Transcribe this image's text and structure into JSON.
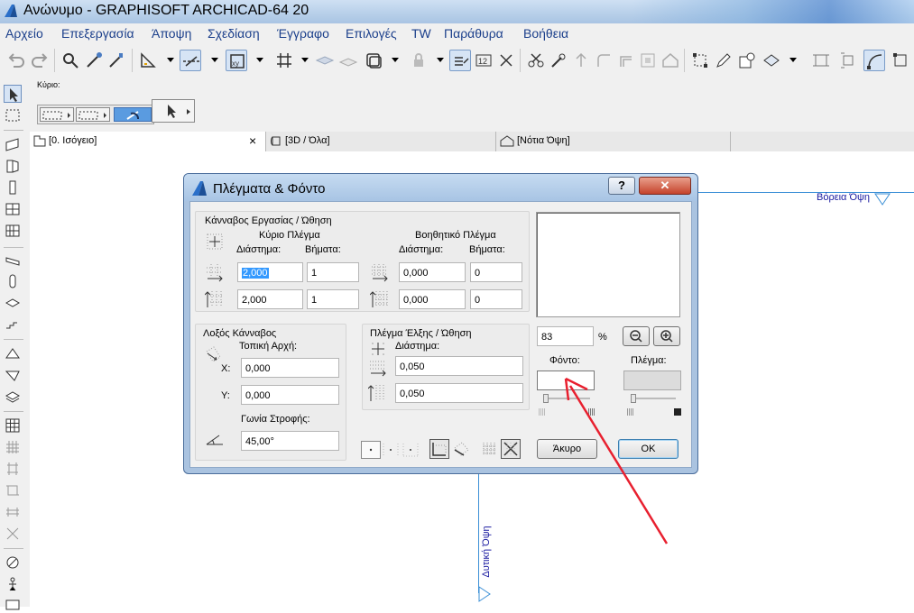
{
  "window": {
    "title": "Ανώνυμο - GRAPHISOFT ARCHICAD-64 20"
  },
  "menu": [
    "Αρχείο",
    "Επεξεργασία",
    "Άποψη",
    "Σχεδίαση",
    "Έγγραφο",
    "Επιλογές",
    "TW",
    "Παράθυρα",
    "Βοήθεια"
  ],
  "infobox": {
    "label": "Κύριο:"
  },
  "tabs": [
    {
      "label": "[0. Ισόγειο]",
      "close": "×"
    },
    {
      "label": "[3D / Όλα]"
    },
    {
      "label": "[Νότια Όψη]"
    }
  ],
  "canvas": {
    "north_label": "Βόρεια Όψη",
    "west_label": "Δυτική Όψη"
  },
  "dialog": {
    "title": "Πλέγματα & Φόντο",
    "help": "?",
    "close": "✕",
    "work_grid": {
      "title": "Κάνναβος Εργασίας / Ώθηση",
      "main_title": "Κύριο Πλέγμα",
      "aux_title": "Βοηθητικό Πλέγμα",
      "spacing_header": "Διάστημα:",
      "steps_header": "Βήματα:",
      "main": {
        "x_spacing": "2,000",
        "x_steps": "1",
        "y_spacing": "2,000",
        "y_steps": "1"
      },
      "aux": {
        "x_spacing": "0,000",
        "x_steps": "0",
        "y_spacing": "0,000",
        "y_steps": "0"
      }
    },
    "rotated_grid": {
      "title": "Λοξός Κάνναβος",
      "origin_label": "Τοπική Αρχή:",
      "x_label": "X:",
      "x_value": "0,000",
      "y_label": "Y:",
      "y_value": "0,000",
      "angle_label": "Γωνία Στροφής:",
      "angle_value": "45,00°"
    },
    "snap_grid": {
      "title": "Πλέγμα Έλξης / Ώθηση",
      "spacing_label": "Διάστημα:",
      "x_value": "0,050",
      "y_value": "0,050"
    },
    "preview": {
      "zoom": "83",
      "percent": "%",
      "background_label": "Φόντο:",
      "grid_label": "Πλέγμα:"
    },
    "buttons": {
      "cancel": "Άκυρο",
      "ok": "OK"
    }
  },
  "colors": {
    "annotation_arrow": "#e8202f",
    "menu_text": "#1b3f8b",
    "title_bar": "#b7cfe9",
    "elevation_marker": "#3a8fd6"
  }
}
